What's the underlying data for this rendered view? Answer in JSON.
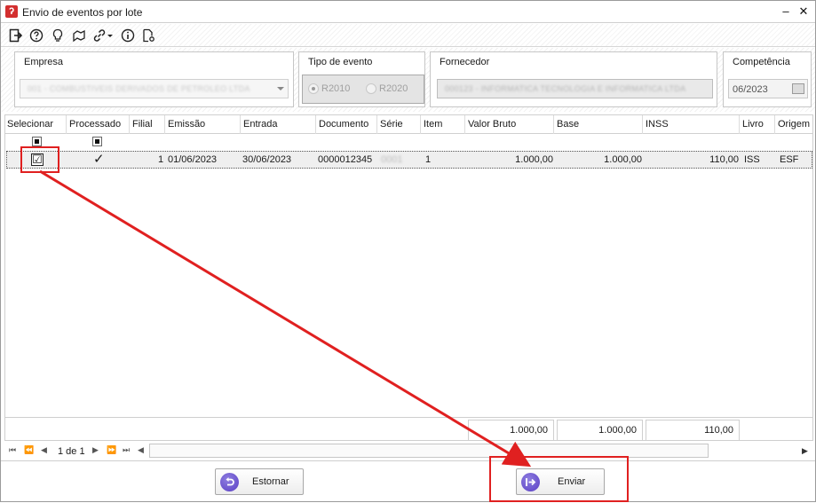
{
  "window": {
    "title": "Envio de eventos por lote",
    "app_icon": "app-logo-icon",
    "minimize_label": "–",
    "close_label": "✕"
  },
  "toolbar": {
    "icons": [
      "exit-icon",
      "help-icon",
      "lightbulb-icon",
      "map-icon",
      "link-icon",
      "chevron-down-icon",
      "info-icon",
      "settings-doc-icon"
    ]
  },
  "filters": {
    "empresa": {
      "label": "Empresa",
      "value": "001 - COMBUSTIVEIS DERIVADOS DE PETROLEO LTDA"
    },
    "tipo_evento": {
      "label": "Tipo de evento",
      "options": [
        "R2010",
        "R2020"
      ],
      "selected": "R2010"
    },
    "fornecedor": {
      "label": "Fornecedor",
      "value": "000123 - INFORMATICA TECNOLOGIA E INFORMATICA LTDA"
    },
    "competencia": {
      "label": "Competência",
      "value": "06/2023"
    }
  },
  "grid": {
    "columns": [
      "Selecionar",
      "Processado",
      "Filial",
      "Emissão",
      "Entrada",
      "Documento",
      "Série",
      "Item",
      "Valor Bruto",
      "Base",
      "INSS",
      "Livro",
      "Origem"
    ],
    "rows": [
      {
        "selecionar": "☑",
        "processado": "✓",
        "filial": "1",
        "emissao": "01/06/2023",
        "entrada": "30/06/2023",
        "documento": "0000012345",
        "serie": "0001",
        "item": "1",
        "valor_bruto": "1.000,00",
        "base": "1.000,00",
        "inss": "110,00",
        "livro": "ISS",
        "origem": "ESF"
      }
    ],
    "totals": {
      "valor_bruto": "1.000,00",
      "base": "1.000,00",
      "inss": "110,00"
    }
  },
  "navigator": {
    "page_text": "1 de 1",
    "first": "⏮",
    "prev_fast": "⏪",
    "prev": "◀",
    "next": "▶",
    "next_fast": "⏩",
    "last": "⏭",
    "scroll_left": "◀",
    "scroll_right": "▶"
  },
  "buttons": {
    "estornar": "Estornar",
    "enviar": "Enviar"
  },
  "colors": {
    "annotation": "#e02020",
    "button_icon": "#5a3fc4"
  }
}
